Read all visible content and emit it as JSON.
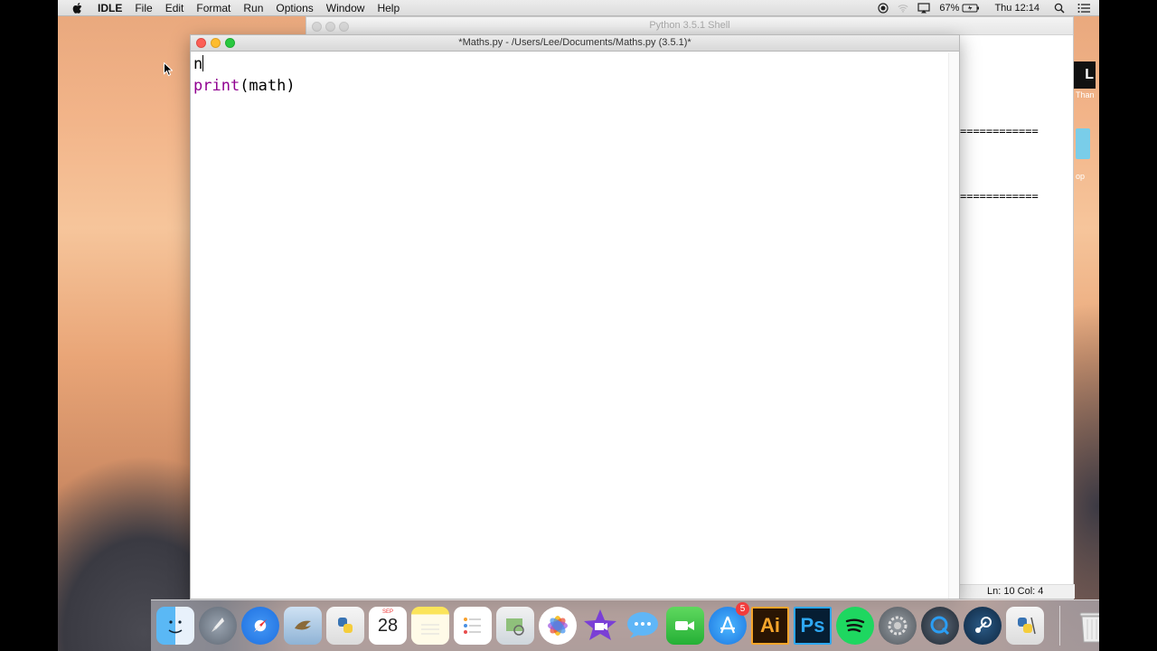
{
  "menubar": {
    "items": [
      "IDLE",
      "File",
      "Edit",
      "Format",
      "Run",
      "Options",
      "Window",
      "Help"
    ],
    "battery": "67%",
    "clock": "Thu 12:14"
  },
  "shell_window": {
    "title": "Python 3.5.1 Shell",
    "separator": "============",
    "status": "Ln: 10  Col: 4"
  },
  "desktop_icons": {
    "label_1": "Than",
    "label_2": "op"
  },
  "editor_window": {
    "title": "*Maths.py - /Users/Lee/Documents/Maths.py (3.5.1)*",
    "line1": "n",
    "line2_keyword": "print",
    "line2_rest": "(math)"
  },
  "dock": {
    "calendar_month": "SEP",
    "calendar_day": "28",
    "app_store_badge": "5",
    "illustrator_label": "Ai",
    "photoshop_label": "Ps"
  },
  "colors": {
    "keyword": "#900090",
    "close": "#fc5f57",
    "minimize": "#fdbc2e",
    "maximize": "#29c83f"
  }
}
